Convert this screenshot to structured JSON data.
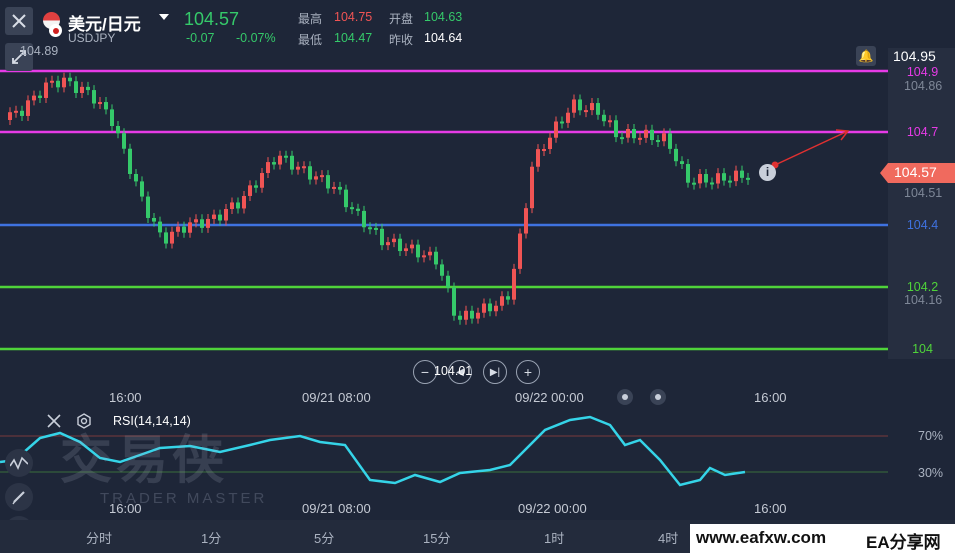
{
  "header": {
    "symbol_name": "美元/日元",
    "symbol_code": "USDJPY",
    "price": "104.57",
    "change": "-0.07",
    "change_pct": "-0.07%",
    "high_label": "最高",
    "high_value": "104.75",
    "open_label": "开盘",
    "open_value": "104.63",
    "low_label": "最低",
    "low_value": "104.47",
    "prev_close_label": "昨收",
    "prev_close_value": "104.64",
    "top_left_price": "104.89"
  },
  "price_axis": {
    "top_value": "104.95",
    "ticks": [
      "104.86",
      "104.51",
      "104.16"
    ],
    "current_price": "104.57",
    "low_label": "104.01"
  },
  "levels": [
    {
      "label": "104.9",
      "color": "#e63be6"
    },
    {
      "label": "104.7",
      "color": "#e63be6"
    },
    {
      "label": "104.4",
      "color": "#3f72e0"
    },
    {
      "label": "104.2",
      "color": "#4fd33a"
    },
    {
      "label": "104",
      "color": "#4fd33a"
    }
  ],
  "time_axis": [
    "16:00",
    "09/21 08:00",
    "09/22 00:00",
    "16:00"
  ],
  "rsi": {
    "label": "RSI(14,14,14)",
    "levels": [
      "70%",
      "30%"
    ],
    "time_axis": [
      "16:00",
      "09/21 08:00",
      "09/22 00:00",
      "16:00"
    ]
  },
  "timeframes": [
    "分时",
    "1分",
    "5分",
    "15分",
    "1时",
    "4时"
  ],
  "watermark": {
    "title": "交易侠",
    "subtitle": "TRADER MASTER"
  },
  "footer": {
    "site": "www.eafxw.com",
    "brand": "EA分享网"
  },
  "colors": {
    "up": "#f05454",
    "down": "#35c96a",
    "background": "#1e2638",
    "rsi_line": "#35d4e8"
  }
}
